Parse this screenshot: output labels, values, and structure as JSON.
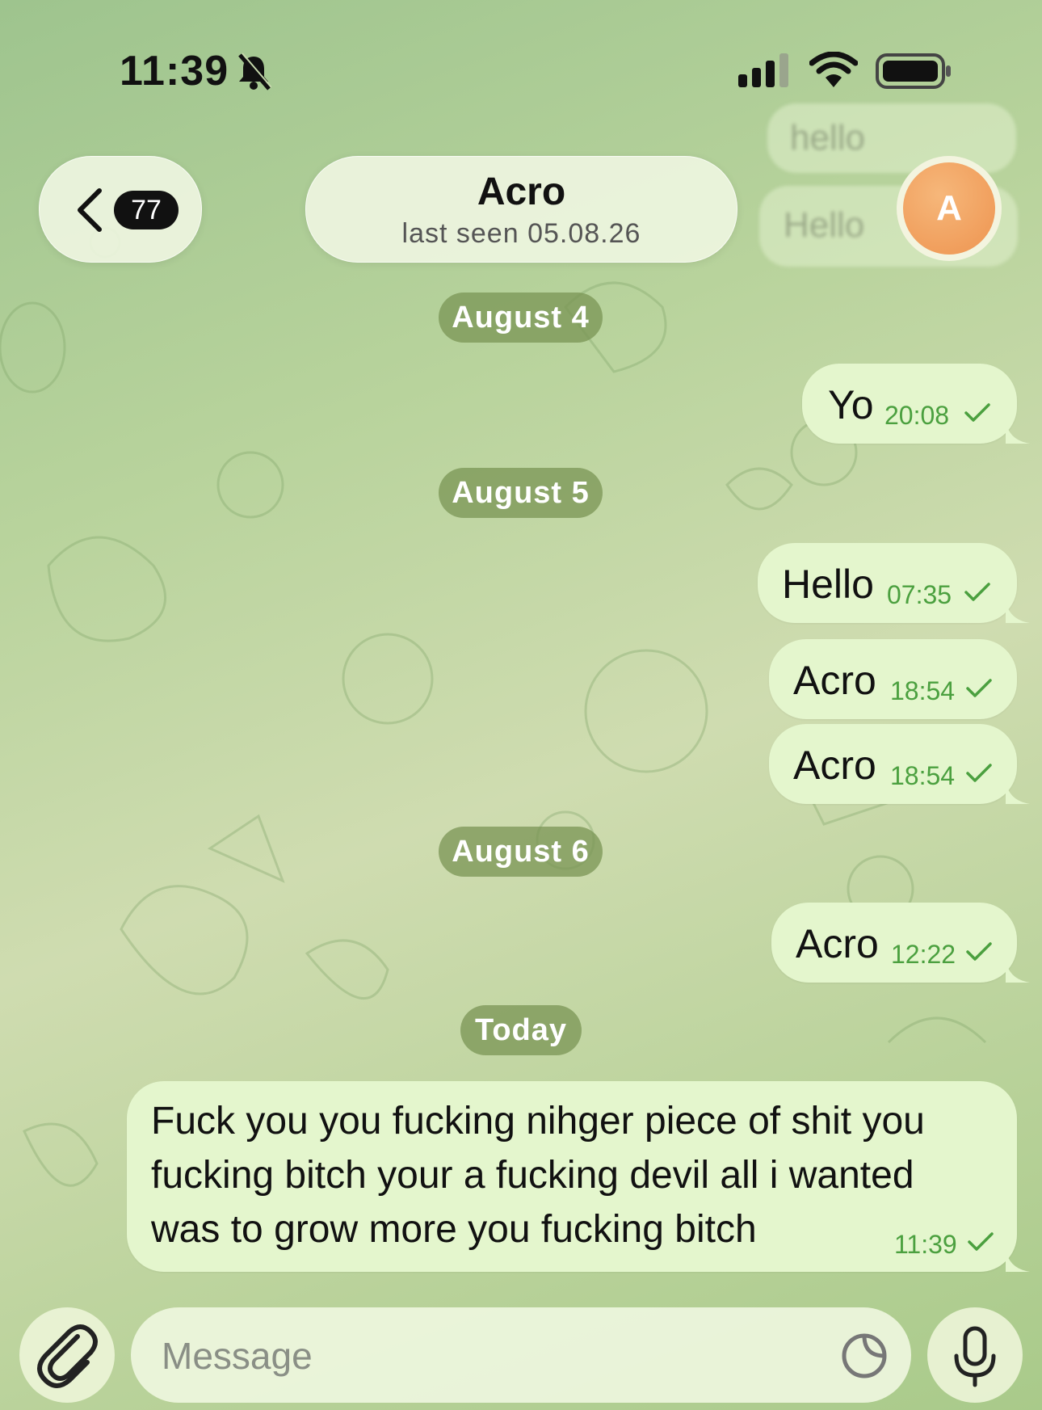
{
  "status_bar": {
    "time": "11:39"
  },
  "header": {
    "back_badge": "77",
    "chat_name": "Acro",
    "last_seen": "last seen 05.08.26",
    "avatar_letter": "A",
    "ghost_messages": [
      "hello",
      "Hello"
    ]
  },
  "messages": [
    {
      "type": "date",
      "label": "August 4"
    },
    {
      "type": "out",
      "text": "Yo",
      "time": "20:08"
    },
    {
      "type": "date",
      "label": "August 5"
    },
    {
      "type": "out",
      "text": "Hello",
      "time": "07:35"
    },
    {
      "type": "out",
      "text": "Acro",
      "time": "18:54"
    },
    {
      "type": "out",
      "text": "Acro",
      "time": "18:54"
    },
    {
      "type": "date",
      "label": "August 6"
    },
    {
      "type": "out",
      "text": "Acro",
      "time": "12:22"
    },
    {
      "type": "date",
      "label": "Today"
    },
    {
      "type": "out",
      "text": "Fuck you you fucking nihger piece of shit you fucking bitch your a fucking devil all i wanted was to grow more you fucking bitch",
      "time": "11:39"
    }
  ],
  "composer": {
    "placeholder": "Message",
    "value": ""
  },
  "colors": {
    "bubble_out": "#e4f6cd",
    "time_green": "#4ba03f",
    "date_chip": "#7a9454",
    "avatar": "#ee9450"
  }
}
